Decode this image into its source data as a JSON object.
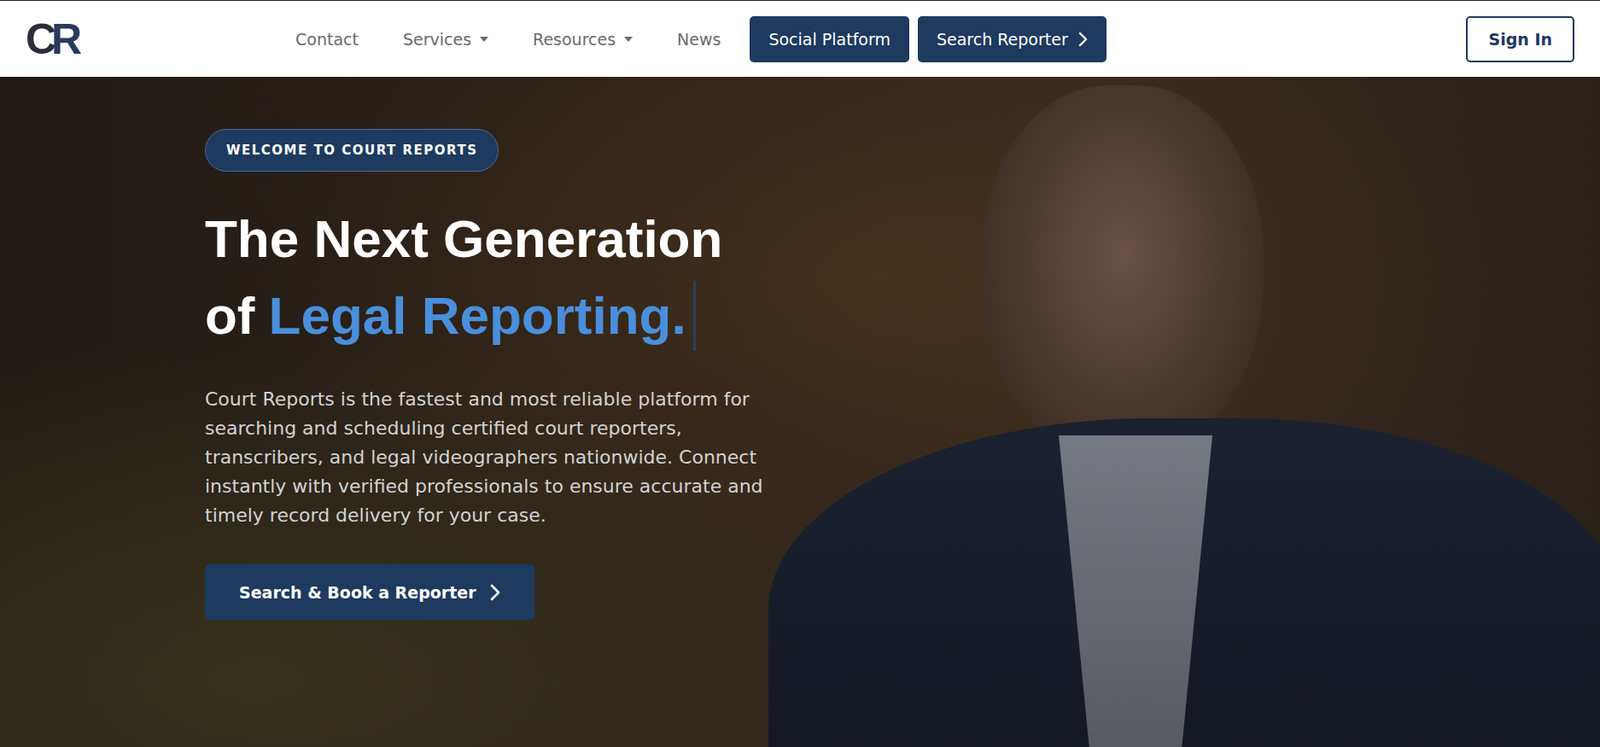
{
  "logo": {
    "text": "CR"
  },
  "nav": {
    "links": [
      {
        "label": "Contact",
        "dropdown": false
      },
      {
        "label": "Services",
        "dropdown": true
      },
      {
        "label": "Resources",
        "dropdown": true
      },
      {
        "label": "News",
        "dropdown": false
      }
    ],
    "buttons": [
      {
        "label": "Social Platform",
        "chevron": false
      },
      {
        "label": "Search Reporter",
        "chevron": true
      }
    ],
    "sign_in": "Sign In"
  },
  "hero": {
    "badge": "WELCOME TO COURT REPORTS",
    "title_line1": "The Next Generation",
    "title_prefix": "of",
    "title_highlight": "Legal Reporting.",
    "description": "Court Reports is the fastest and most reliable platform for searching and scheduling certified court reporters, transcribers, and legal videographers nationwide. Connect instantly with verified professionals to ensure accurate and timely record delivery for your case.",
    "cta": "Search & Book a Reporter"
  }
}
